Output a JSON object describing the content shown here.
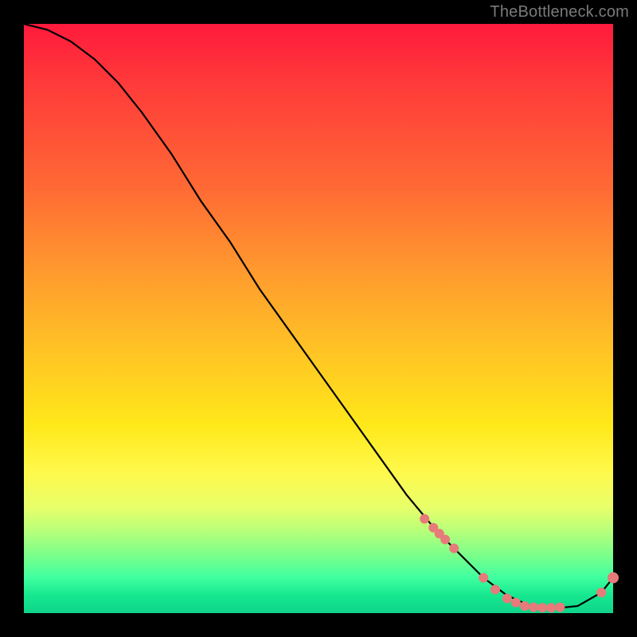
{
  "watermark": "TheBottleneck.com",
  "colors": {
    "background": "#000000",
    "gradient_top": "#ff1a3c",
    "gradient_bottom": "#0fd48a",
    "curve": "#000000",
    "dots": "#e77a7a"
  },
  "chart_data": {
    "type": "line",
    "title": "",
    "xlabel": "",
    "ylabel": "",
    "xlim": [
      0,
      100
    ],
    "ylim": [
      0,
      100
    ],
    "series": [
      {
        "name": "bottleneck-curve",
        "x": [
          0,
          4,
          8,
          12,
          16,
          20,
          25,
          30,
          35,
          40,
          45,
          50,
          55,
          60,
          65,
          70,
          74,
          78,
          82,
          86,
          90,
          94,
          98,
          100
        ],
        "y": [
          100,
          99,
          97,
          94,
          90,
          85,
          78,
          70,
          63,
          55,
          48,
          41,
          34,
          27,
          20,
          14,
          10,
          6,
          3,
          1.2,
          0.8,
          1.2,
          3.5,
          6
        ]
      }
    ],
    "markers": {
      "name": "highlight-dots",
      "x": [
        68,
        69.5,
        70.5,
        71.5,
        73,
        78,
        80,
        82,
        83.5,
        85,
        86.5,
        88,
        89.5,
        91,
        98,
        100
      ],
      "y": [
        16,
        14.5,
        13.5,
        12.5,
        11,
        6,
        4,
        2.5,
        1.8,
        1.2,
        1.0,
        0.9,
        0.9,
        1.0,
        3.5,
        6
      ]
    }
  }
}
